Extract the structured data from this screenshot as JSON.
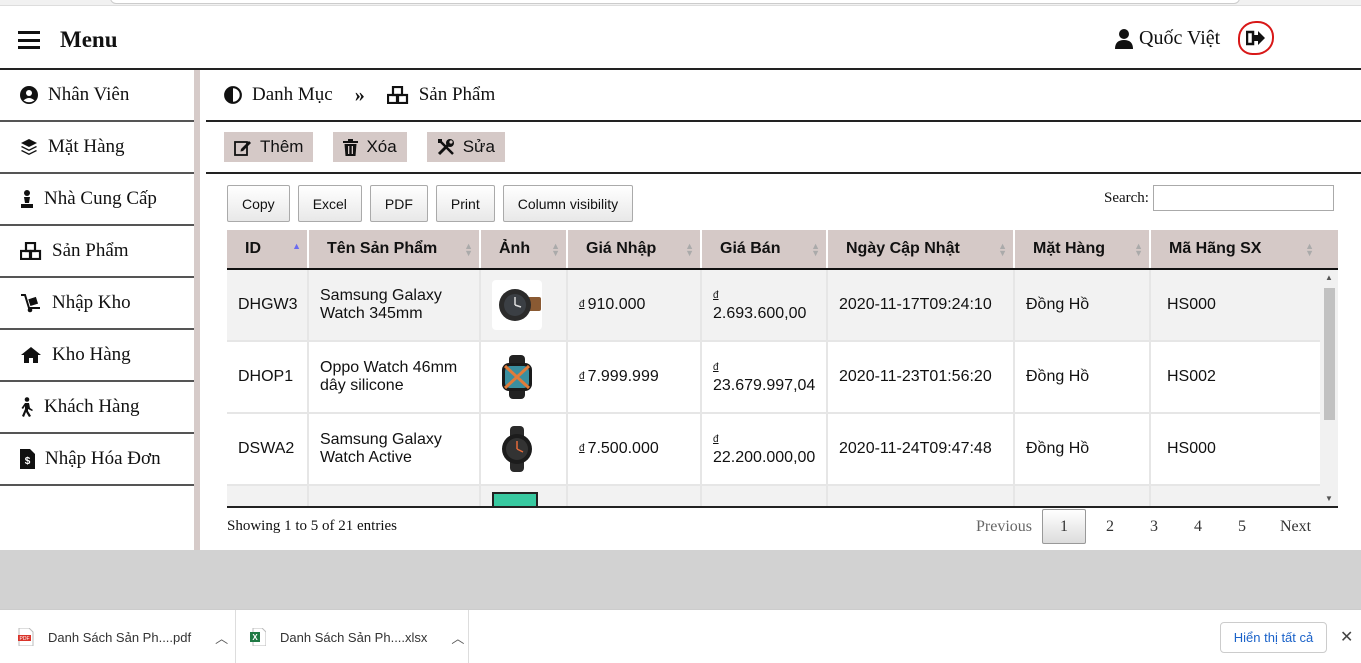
{
  "header": {
    "menu_label": "Menu",
    "user_name": "Quốc Việt"
  },
  "sidebar": {
    "items": [
      {
        "label": "Nhân Viên",
        "icon": "user-circle-icon"
      },
      {
        "label": "Mặt Hàng",
        "icon": "layers-icon"
      },
      {
        "label": "Nhà Cung Cấp",
        "icon": "chess-pawn-icon"
      },
      {
        "label": "Sản Phẩm",
        "icon": "cubes-icon"
      },
      {
        "label": "Nhập Kho",
        "icon": "dolly-icon"
      },
      {
        "label": "Kho Hàng",
        "icon": "home-icon"
      },
      {
        "label": "Khách Hàng",
        "icon": "walking-icon"
      },
      {
        "label": "Nhập Hóa Đơn",
        "icon": "invoice-icon"
      }
    ]
  },
  "breadcrumb": {
    "parent": "Danh Mục",
    "current": "Sản Phẩm"
  },
  "actions": {
    "add": "Thêm",
    "delete": "Xóa",
    "edit": "Sửa"
  },
  "export_buttons": [
    "Copy",
    "Excel",
    "PDF",
    "Print",
    "Column visibility"
  ],
  "search": {
    "label": "Search:",
    "value": ""
  },
  "table": {
    "headers": [
      "ID",
      "Tên Sản Phẩm",
      "Ảnh",
      "Giá Nhập",
      "Giá Bán",
      "Ngày Cập Nhật",
      "Mặt Hàng",
      "Mã Hãng SX"
    ],
    "currency_symbol": "đ",
    "rows": [
      {
        "id": "DHGW3",
        "name": "Samsung Galaxy Watch 345mm",
        "image": "watch-brown-strap",
        "cost": "910.000",
        "price": "2.693.600,00",
        "updated": "2020-11-17T09:24:10",
        "category": "Đồng Hồ",
        "maker": "HS000"
      },
      {
        "id": "DHOP1",
        "name": "Oppo Watch 46mm dây silicone",
        "image": "watch-black-square",
        "cost": "7.999.999",
        "price": "23.679.997,04",
        "updated": "2020-11-23T01:56:20",
        "category": "Đồng Hồ",
        "maker": "HS002"
      },
      {
        "id": "DSWA2",
        "name": "Samsung Galaxy Watch Active",
        "image": "watch-black-round",
        "cost": "7.500.000",
        "price": "22.200.000,00",
        "updated": "2020-11-24T09:47:48",
        "category": "Đồng Hồ",
        "maker": "HS000"
      }
    ]
  },
  "pagination": {
    "info": "Showing 1 to 5 of 21 entries",
    "previous": "Previous",
    "next": "Next",
    "pages": [
      "1",
      "2",
      "3",
      "4",
      "5"
    ],
    "current": "1"
  },
  "downloads": {
    "items": [
      {
        "name": "Danh Sách Sản Ph....pdf",
        "type": "pdf"
      },
      {
        "name": "Danh Sách Sản Ph....xlsx",
        "type": "xlsx"
      }
    ],
    "show_all": "Hiển thị tất cả"
  },
  "colors": {
    "accent_bg": "#d5c9c7",
    "logout_circle": "#d81818"
  }
}
